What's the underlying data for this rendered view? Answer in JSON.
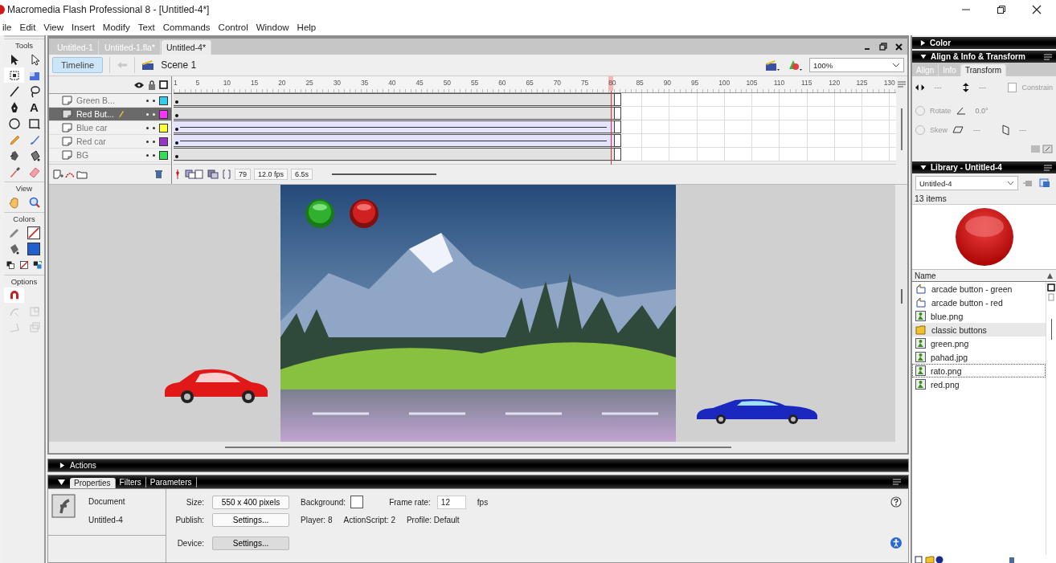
{
  "window": {
    "title": "Macromedia Flash Professional 8 - [Untitled-4*]"
  },
  "menu": [
    "ile",
    "Edit",
    "View",
    "Insert",
    "Modify",
    "Text",
    "Commands",
    "Control",
    "Window",
    "Help"
  ],
  "tools": [
    {
      "label": "Tools",
      "items": [
        {
          "kind": "arrow",
          "selected": false
        },
        {
          "kind": "subselect",
          "selected": false
        },
        {
          "kind": "free-transform",
          "selected": true
        },
        {
          "kind": "gradient-transform",
          "selected": false
        },
        {
          "kind": "line",
          "selected": false
        },
        {
          "kind": "lasso",
          "selected": false
        },
        {
          "kind": "pen",
          "selected": false
        },
        {
          "kind": "text",
          "glyph": "A",
          "selected": false
        },
        {
          "kind": "oval",
          "selected": false
        },
        {
          "kind": "rectangle",
          "selected": false
        },
        {
          "kind": "pencil",
          "selected": false
        },
        {
          "kind": "brush",
          "selected": false
        },
        {
          "kind": "ink-bottle",
          "selected": false
        },
        {
          "kind": "bucket",
          "selected": false
        },
        {
          "kind": "eyedropper",
          "selected": false
        },
        {
          "kind": "eraser",
          "selected": false
        }
      ]
    },
    {
      "label": "View",
      "items": [
        {
          "kind": "hand",
          "selected": false
        },
        {
          "kind": "zoom",
          "selected": false
        }
      ]
    },
    {
      "label": "Colors",
      "items": [
        {
          "kind": "stroke"
        },
        {
          "kind": "swatch-none"
        },
        {
          "kind": "fill"
        },
        {
          "kind": "swatch",
          "color": "#1f5fd0"
        },
        {
          "kind": "mini-default"
        },
        {
          "kind": "mini-none"
        },
        {
          "kind": "mini-swap"
        }
      ]
    },
    {
      "label": "Options",
      "items": [
        {
          "kind": "snap",
          "selected": true,
          "disabled": false
        },
        {
          "kind": "blank"
        },
        {
          "kind": "smooth",
          "selected": false,
          "disabled": true
        },
        {
          "kind": "scale",
          "selected": false,
          "disabled": true
        },
        {
          "kind": "rotate",
          "selected": false,
          "disabled": true
        },
        {
          "kind": "distort",
          "selected": false,
          "disabled": true
        }
      ]
    }
  ],
  "document_tabs": [
    {
      "label": "Untitled-1",
      "selected": false
    },
    {
      "label": "Untitled-1.fla*",
      "selected": false
    },
    {
      "label": "Untitled-4*",
      "selected": true
    }
  ],
  "edit_bar": {
    "timeline_button": "Timeline",
    "scene": "Scene 1",
    "zoom": "100%"
  },
  "timeline": {
    "ruler": [
      "1",
      "5",
      "10",
      "15",
      "20",
      "25",
      "30",
      "35",
      "40",
      "45",
      "50",
      "55",
      "60",
      "65",
      "70",
      "75",
      "80",
      "85",
      "90",
      "95",
      "100",
      "105",
      "110",
      "115",
      "120",
      "125",
      "130"
    ],
    "layers": [
      {
        "name": "Green B...",
        "selected": false,
        "color": "#33ccee",
        "tween": false
      },
      {
        "name": "Red But...",
        "selected": true,
        "color": "#ff33ff",
        "tween": false
      },
      {
        "name": "Blue car",
        "selected": false,
        "color": "#ffff33",
        "tween": true
      },
      {
        "name": "Red car",
        "selected": false,
        "color": "#9933cc",
        "tween": true
      },
      {
        "name": "BG",
        "selected": false,
        "color": "#33dd55",
        "tween": false
      }
    ],
    "current_frame": "79",
    "frame_rate": "12.0 fps",
    "elapsed": "6.5s"
  },
  "actions_panel": {
    "title": "Actions",
    "expanded": false
  },
  "properties": {
    "tabs": [
      {
        "label": "Properties",
        "selected": true
      },
      {
        "label": "Filters",
        "selected": false
      },
      {
        "label": "Parameters",
        "selected": false
      }
    ],
    "doc_type": "Document",
    "doc_name": "Untitled-4",
    "size_label": "Size:",
    "size": "550 x 400 pixels",
    "background_label": "Background:",
    "frame_rate_label": "Frame rate:",
    "frame_rate": "12",
    "fps_unit": "fps",
    "publish_label": "Publish:",
    "publish_button": "Settings...",
    "player": "Player: 8",
    "actionscript": "ActionScript: 2",
    "profile": "Profile: Default",
    "device_label": "Device:",
    "device_button": "Settings..."
  },
  "color_panel": {
    "title": "Color",
    "expanded": false
  },
  "transform_panel": {
    "title": "Align & Info & Transform",
    "expanded": true,
    "tabs": [
      {
        "label": "Align",
        "selected": false
      },
      {
        "label": "Info",
        "selected": false
      },
      {
        "label": "Transform",
        "selected": true
      }
    ],
    "width": "---",
    "height": "---",
    "constrain": {
      "label": "Constrain",
      "checked": false
    },
    "rotate": {
      "label": "Rotate",
      "selected": false
    },
    "rotate_value": "0.0°",
    "skew": {
      "label": "Skew",
      "selected": false
    },
    "skew_h": "---",
    "skew_v": "---"
  },
  "library": {
    "title": "Library - Untitled-4",
    "expanded": true,
    "document": "Untitled-4",
    "count": "13 items",
    "column": "Name",
    "items": [
      {
        "name": "arcade button - green",
        "kind": "button",
        "selected": false,
        "focused": false
      },
      {
        "name": "arcade button - red",
        "kind": "button",
        "selected": false,
        "focused": false
      },
      {
        "name": "blue.png",
        "kind": "bitmap",
        "selected": false,
        "focused": false
      },
      {
        "name": "classic buttons",
        "kind": "folder",
        "selected": true,
        "focused": false
      },
      {
        "name": "green.png",
        "kind": "bitmap",
        "selected": false,
        "focused": false
      },
      {
        "name": "pahad.jpg",
        "kind": "bitmap",
        "selected": false,
        "focused": false
      },
      {
        "name": "rato.png",
        "kind": "bitmap",
        "selected": false,
        "focused": true
      },
      {
        "name": "red.png",
        "kind": "bitmap",
        "selected": false,
        "focused": false
      }
    ]
  }
}
